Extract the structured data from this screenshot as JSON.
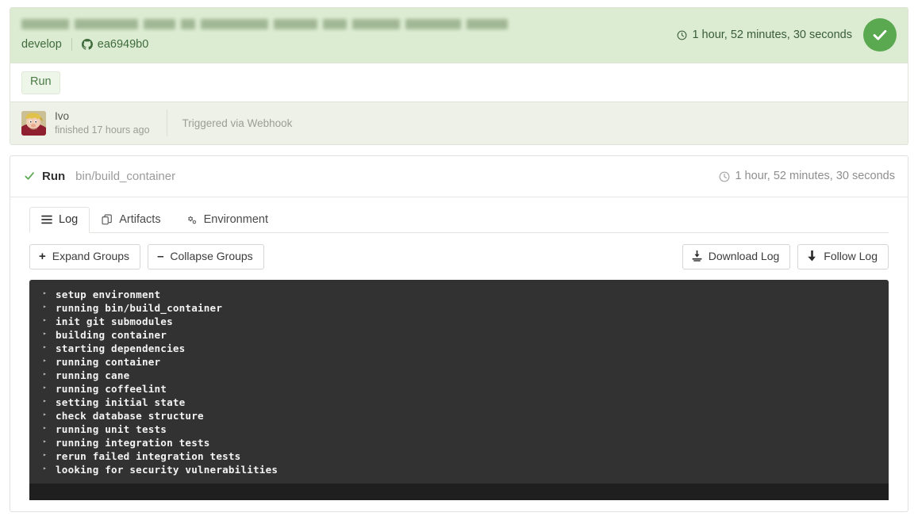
{
  "build": {
    "title_redacted": true,
    "title_block_widths": [
      60,
      80,
      40,
      18,
      85,
      55,
      30,
      60,
      70,
      52
    ],
    "branch": "develop",
    "commit_sha": "ea6949b0",
    "commit_icon": "github-mark-icon",
    "duration": "1 hour, 52 minutes, 30 seconds",
    "clock_icon": "clock-icon",
    "status": "passed",
    "status_icon": "check-circle-icon",
    "status_color": "#5aa84f"
  },
  "run_tab": {
    "label": "Run"
  },
  "author": {
    "name": "Ivo",
    "finished": "finished 17 hours ago",
    "trigger": "Triggered via Webhook",
    "avatar_icon": "avatar"
  },
  "run_detail": {
    "check_icon": "check-icon",
    "label": "Run",
    "command": "bin/build_container",
    "clock_icon": "clock-icon",
    "duration": "1 hour, 52 minutes, 30 seconds"
  },
  "tabs": [
    {
      "label": "Log",
      "icon": "hamburger-icon",
      "active": true
    },
    {
      "label": "Artifacts",
      "icon": "artifacts-icon",
      "active": false
    },
    {
      "label": "Environment",
      "icon": "gears-icon",
      "active": false
    }
  ],
  "toolbar": {
    "expand_label": "Expand Groups",
    "expand_glyph": "+",
    "collapse_label": "Collapse Groups",
    "collapse_glyph": "–",
    "download_label": "Download Log",
    "download_icon": "download-icon",
    "follow_label": "Follow Log",
    "follow_icon": "arrow-down-icon"
  },
  "log": {
    "caret": "▸",
    "lines": [
      "setup environment",
      "running bin/build_container",
      "init git submodules",
      "building container",
      "starting dependencies",
      "running container",
      "running cane",
      "running coffeelint",
      "setting initial state",
      "check database structure",
      "running unit tests",
      "running integration tests",
      "rerun failed integration tests",
      "looking for security vulnerabilities"
    ]
  }
}
